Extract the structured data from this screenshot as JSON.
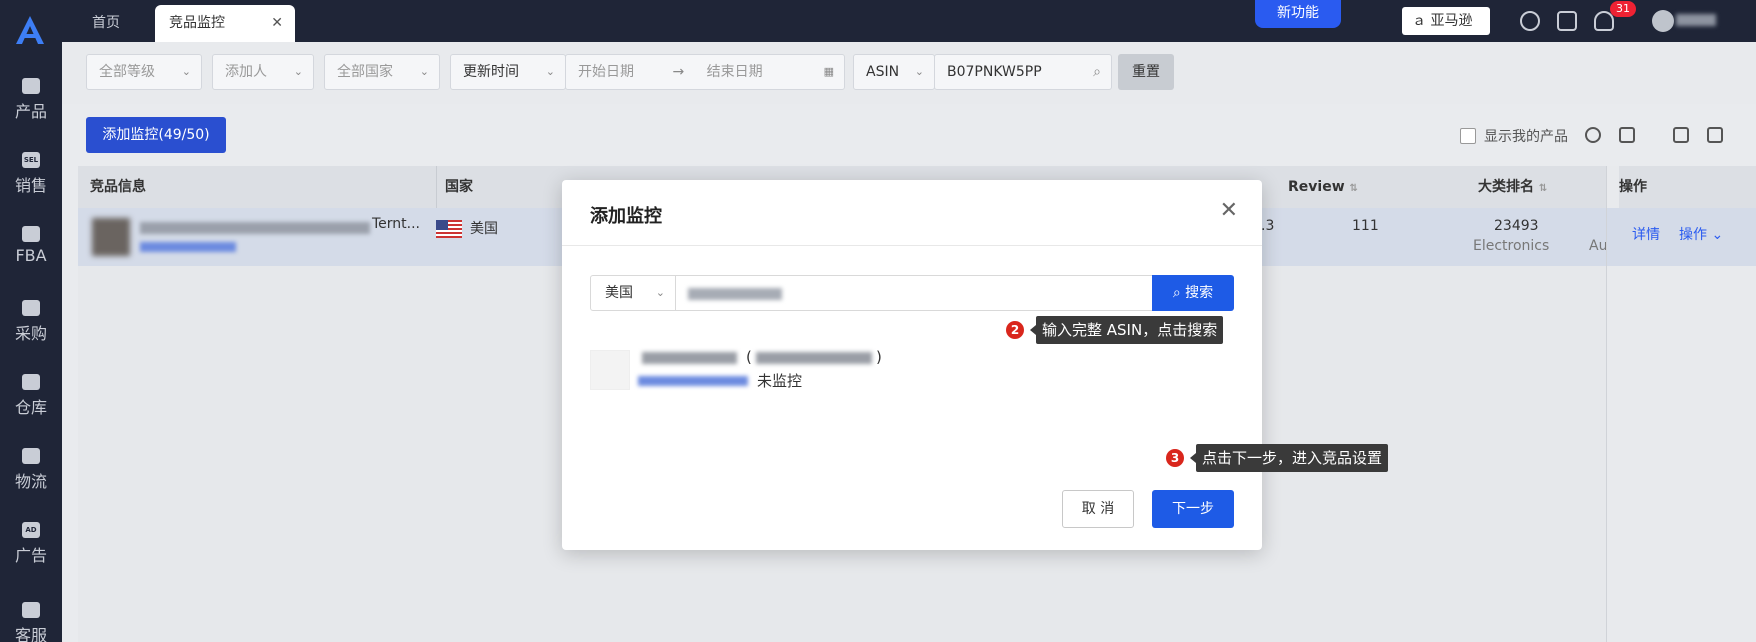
{
  "tabs": {
    "home": "首页",
    "active": "竞品监控"
  },
  "header": {
    "new_feature": "新功能",
    "amazon": "亚马逊",
    "notification_count": "31"
  },
  "sidebar": {
    "items": [
      {
        "label": "产品",
        "icon": "bag-icon"
      },
      {
        "label": "销售",
        "icon": "sell-icon"
      },
      {
        "label": "FBA",
        "icon": "amazon-icon"
      },
      {
        "label": "采购",
        "icon": "cart-icon"
      },
      {
        "label": "仓库",
        "icon": "warehouse-icon"
      },
      {
        "label": "物流",
        "icon": "truck-icon"
      },
      {
        "label": "广告",
        "icon": "ad-icon"
      },
      {
        "label": "客服",
        "icon": "mail-icon"
      }
    ]
  },
  "filters": {
    "level": "全部等级",
    "adder": "添加人",
    "country": "全部国家",
    "time_type": "更新时间",
    "start_date": "开始日期",
    "end_date": "结束日期",
    "search_type": "ASIN",
    "search_value": "B07PNKW5PP",
    "reset": "重置"
  },
  "toolbar": {
    "add_monitor": "添加监控(49/50)",
    "show_mine": "显示我的产品"
  },
  "table": {
    "headers": {
      "product": "竞品信息",
      "country": "国家",
      "review": "Review",
      "rank": "大类排名",
      "action": "操作"
    },
    "row": {
      "title_fragment": "Ternt...",
      "country": "美国",
      "rating_fragment": ".3",
      "review": "111",
      "rank": "23493",
      "category": "Electronics",
      "category_fragment": "Au",
      "detail": "详情",
      "action": "操作"
    }
  },
  "modal": {
    "title": "添加监控",
    "country": "美国",
    "search_button": "搜索",
    "tip2": "输入完整 ASIN，点击搜索",
    "step2": "2",
    "result_paren_open": "(",
    "result_paren_close": ")",
    "result_status": "未监控",
    "tip3": "点击下一步，进入竞品设置",
    "step3": "3",
    "cancel": "取 消",
    "next": "下一步"
  }
}
